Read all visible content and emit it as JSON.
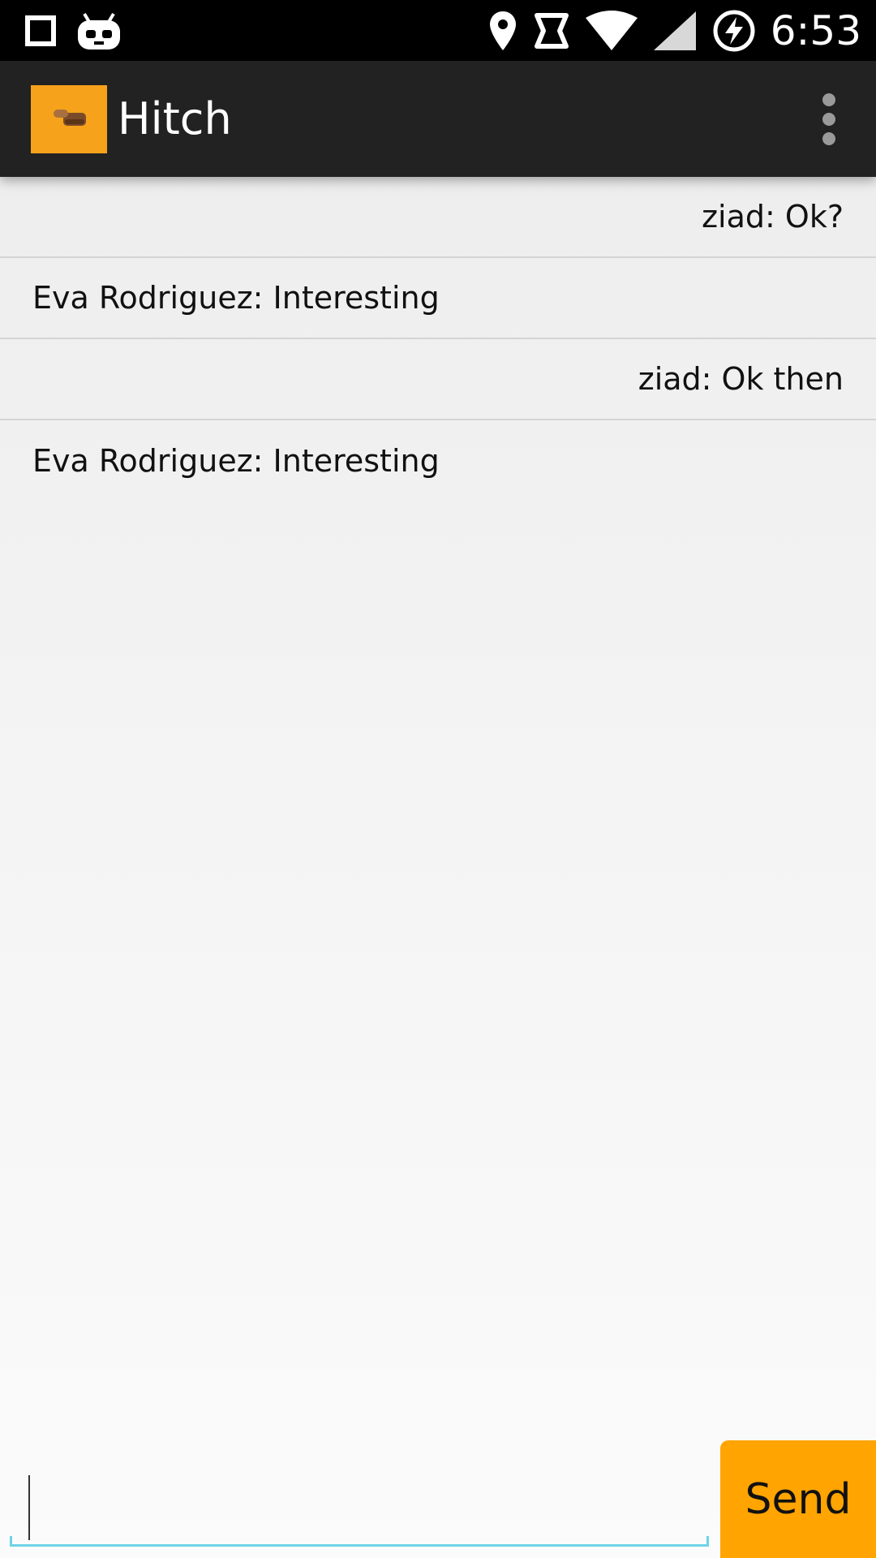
{
  "status_bar": {
    "time": "6:53",
    "icons": [
      "square-notification-icon",
      "robot-notification-icon",
      "location-pin-icon",
      "nfc-icon",
      "wifi-icon",
      "battery-charging-icon"
    ]
  },
  "action_bar": {
    "title": "Hitch",
    "logo_icon": "thumbs-up-hitchhike-icon",
    "menu_icon": "overflow-menu-icon"
  },
  "messages": [
    {
      "text": "ziad: Ok?",
      "align": "right"
    },
    {
      "text": "Eva Rodriguez: Interesting",
      "align": "left"
    },
    {
      "text": "ziad: Ok then",
      "align": "right"
    },
    {
      "text": "Eva Rodriguez: Interesting",
      "align": "left"
    }
  ],
  "composer": {
    "input_value": "",
    "send_label": "Send"
  },
  "colors": {
    "status_bar_bg": "#000000",
    "action_bar_bg": "#222222",
    "brand_orange": "#ffa400",
    "logo_bg": "#f7a21b",
    "input_underline": "#6fd3e6"
  }
}
